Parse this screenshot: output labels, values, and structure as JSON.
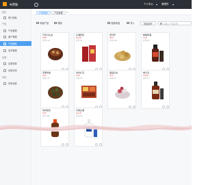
{
  "app": {
    "title": "有赞猫",
    "accent": "#4d9ff0",
    "brand": "#f39c12"
  },
  "header": {
    "menu_a": "个人中心",
    "menu_b": "管理员"
  },
  "sidebar": {
    "groups": [
      {
        "label": "首页",
        "items": [
          {
            "label": "统计面板",
            "icon": "chart-icon",
            "active": false
          }
        ]
      },
      {
        "label": "产品",
        "items": [
          {
            "label": "产品管理",
            "icon": "box-icon",
            "active": false
          },
          {
            "label": "客户管理",
            "icon": "user-icon",
            "active": false
          },
          {
            "label": "产品图库",
            "icon": "image-icon",
            "active": true
          },
          {
            "label": "素材管理",
            "icon": "folder-icon",
            "active": false
          }
        ]
      },
      {
        "label": "店铺",
        "items": [
          {
            "label": "店铺设置",
            "icon": "cloud-icon",
            "active": false
          },
          {
            "label": "运营活动",
            "icon": "gift-icon",
            "active": false
          }
        ]
      },
      {
        "label": "系统",
        "items": [
          {
            "label": "系统设置",
            "icon": "gear-icon",
            "active": false
          }
        ]
      }
    ]
  },
  "tabs": [
    {
      "label": "产品图库"
    },
    {
      "label": "产品管理"
    }
  ],
  "toolbar": {
    "new_label": "新建产品",
    "delete_label": "删除",
    "filter_label": "图库筛选",
    "import_label": "导入",
    "batch_label": "批量操作",
    "search_placeholder": "请输入产品名称"
  },
  "products": [
    {
      "title": "巧克力礼盒",
      "price": "¥88",
      "meta": "库存 120",
      "img": "chocolate"
    },
    {
      "title": "红酒套装",
      "price": "¥168",
      "meta": "库存 45",
      "img": "wine-box"
    },
    {
      "title": "费列罗",
      "price": "¥59",
      "meta": "库存 230",
      "img": "bonbon"
    },
    {
      "title": "精酿啤酒",
      "price": "¥32",
      "meta": "库存 88",
      "img": "beer"
    },
    {
      "title": "坚果拼盘",
      "price": "¥45",
      "meta": "库存 150",
      "img": "nuts"
    },
    {
      "title": "零食礼包",
      "price": "¥36",
      "meta": "库存 96",
      "img": "snack-box"
    },
    {
      "title": "甜品礼盒",
      "price": "¥52",
      "meta": "库存 60",
      "img": "dessert"
    },
    {
      "title": "威士忌",
      "price": "¥268",
      "meta": "库存 18",
      "img": "whisky"
    },
    {
      "title": "饮料组合",
      "price": "¥25",
      "meta": "库存 300",
      "img": "soda"
    },
    {
      "title": "高粱白酒",
      "price": "¥128",
      "meta": "库存 40",
      "img": "baijiu"
    }
  ]
}
